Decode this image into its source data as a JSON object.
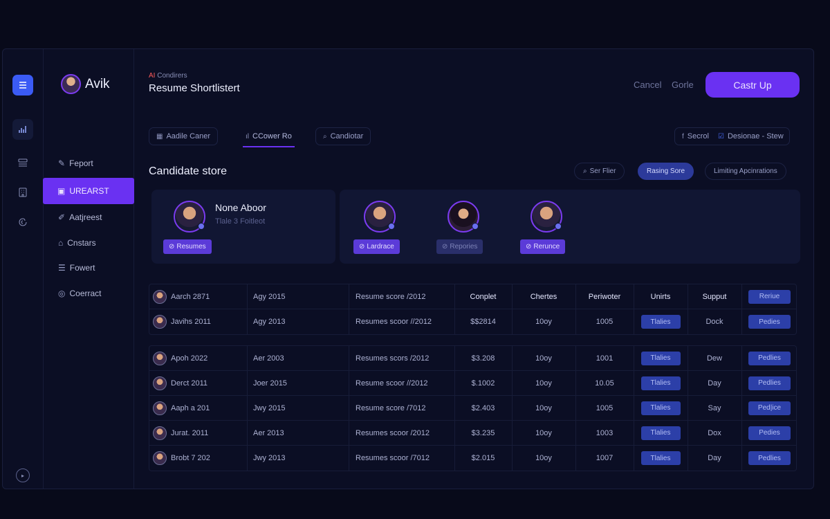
{
  "brand": {
    "name": "Avik"
  },
  "rail": {
    "icons": [
      "menu-icon",
      "chart-icon",
      "list-icon",
      "building-icon",
      "brain-icon",
      "play-icon"
    ]
  },
  "nav": {
    "items": [
      {
        "icon": "pencil-icon",
        "glyph": "✎",
        "label": "Feport"
      },
      {
        "icon": "folder-icon",
        "glyph": "▣",
        "label": "UREARST"
      },
      {
        "icon": "tag-icon",
        "glyph": "✐",
        "label": "Aatjreest"
      },
      {
        "icon": "lock-icon",
        "glyph": "⌂",
        "label": "Cnstars"
      },
      {
        "icon": "doc-icon",
        "glyph": "☰",
        "label": "Fowert"
      },
      {
        "icon": "chat-icon",
        "glyph": "◎",
        "label": "Coerract"
      }
    ]
  },
  "header": {
    "eyebrow_ai": "AI",
    "eyebrow_rest": "Condirers",
    "title": "Resume Shortlistert",
    "cancel": "Cancel",
    "secondary": "Gorle",
    "cta": "Castr Up"
  },
  "tabs": [
    {
      "glyph": "▦",
      "label": "Aadile Caner"
    },
    {
      "glyph": "ıl",
      "label": "CCower Ro"
    },
    {
      "glyph": "⌕",
      "label": "Candiotar"
    }
  ],
  "tabs_right": [
    {
      "glyph": "f",
      "label": "Secrol"
    },
    {
      "glyph": "☑",
      "label": "Desionae - Stew"
    }
  ],
  "section": {
    "title": "Candidate store",
    "filter": "Ser Flier",
    "rating": "Rasing Sore",
    "limiting": "Limiting Apcinrations"
  },
  "cards": {
    "featured": {
      "name": "None Aboor",
      "subtitle": "Tlale 3 Foitleot",
      "chip": "Resumes"
    },
    "others": [
      {
        "chip": "Lardrace"
      },
      {
        "chip": "Repories"
      },
      {
        "chip": "Rerunce"
      }
    ]
  },
  "table_head": {
    "name": "Aarch 2871",
    "date": "Agy 2015",
    "score": "Resume score /2012",
    "cols": [
      "Conplet",
      "Chertes",
      "Periwoter",
      "Unirts",
      "Supput"
    ],
    "action": "Reriue"
  },
  "table_row1": {
    "name": "Javihs 2011",
    "date": "Agy 2013",
    "score": "Resumes scoor //2012",
    "v1": "$$2814",
    "v2": "10oy",
    "v3": "1005",
    "btn": "Tlalies",
    "v5": "Dock",
    "action": "Pedies"
  },
  "table_rows": [
    {
      "name": "Apoh 2022",
      "date": "Aer 2003",
      "score": "Resumes scors /2012",
      "v1": "$3.208",
      "v2": "10oy",
      "v3": "1001",
      "btn": "Tlalies",
      "v5": "Dew",
      "action": "Pedlies"
    },
    {
      "name": "Derct 2011",
      "date": "Joer 2015",
      "score": "Resume scoor //2012",
      "v1": "$.1002",
      "v2": "10oy",
      "v3": "10.05",
      "btn": "Tlalies",
      "v5": "Day",
      "action": "Pedlies"
    },
    {
      "name": "Aaph a 201",
      "date": "Jwy 2015",
      "score": "Resume score /7012",
      "v1": "$2.403",
      "v2": "10oy",
      "v3": "1005",
      "btn": "Tlalies",
      "v5": "Say",
      "action": "Ped|ice"
    },
    {
      "name": "Jurat. 2011",
      "date": "Aer 2013",
      "score": "Resumes scoor /2012",
      "v1": "$3.235",
      "v2": "10oy",
      "v3": "1003",
      "btn": "Tlalies",
      "v5": "Dox",
      "action": "Pedies"
    },
    {
      "name": "Brobt 7 202",
      "date": "Jwy 2013",
      "score": "Resumes scoor /7012",
      "v1": "$2.015",
      "v2": "10oy",
      "v3": "1007",
      "btn": "Tlalies",
      "v5": "Day",
      "action": "Pedlies"
    }
  ]
}
